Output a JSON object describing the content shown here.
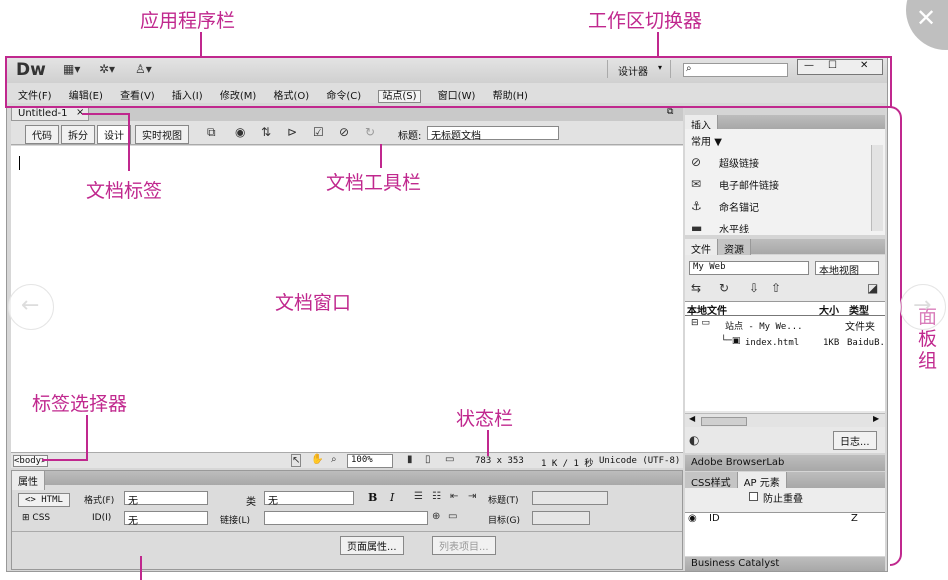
{
  "annotations": {
    "app_bar": "应用程序栏",
    "workspace_switcher": "工作区切换器",
    "doc_tab": "文档标签",
    "doc_toolbar": "文档工具栏",
    "doc_window": "文档窗口",
    "tag_selector": "标签选择器",
    "status_bar": "状态栏",
    "panel_group": "面板组"
  },
  "app": {
    "logo": "Dw",
    "workspace_label": "设计器",
    "window_min": "—",
    "window_max": "☐",
    "window_close": "✕"
  },
  "menu": [
    "文件(F)",
    "编辑(E)",
    "查看(V)",
    "插入(I)",
    "修改(M)",
    "格式(O)",
    "命令(C)",
    "站点(S)",
    "窗口(W)",
    "帮助(H)"
  ],
  "document": {
    "tab_name": "Untitled-1",
    "tab_close": "×",
    "view_buttons": [
      "代码",
      "拆分",
      "设计",
      "实时视图"
    ],
    "title_label": "标题:",
    "title_value": "无标题文档"
  },
  "statusbar": {
    "tag": "<body>",
    "zoom": "100%",
    "size": "783 x 353",
    "download": "1 K / 1 秒",
    "encoding": "Unicode (UTF-8)"
  },
  "properties": {
    "header": "属性",
    "html_btn": "HTML",
    "css_btn": "CSS",
    "format_label": "格式(F)",
    "format_value": "无",
    "class_label": "类",
    "class_value": "无",
    "id_label": "ID(I)",
    "id_value": "无",
    "link_label": "链接(L)",
    "link_value": "",
    "title_label": "标题(T)",
    "target_label": "目标(G)",
    "bold": "B",
    "italic": "I",
    "page_props_btn": "页面属性...",
    "list_item_btn": "列表项目..."
  },
  "panels": {
    "insert_tab": "插入",
    "insert_category": "常用",
    "insert_items": [
      "超级链接",
      "电子邮件链接",
      "命名锚记",
      "水平线"
    ],
    "files_tabs": [
      "文件",
      "资源"
    ],
    "site_value": "My Web",
    "view_value": "本地视图",
    "files_cols": [
      "本地文件",
      "大小",
      "类型"
    ],
    "files_rows": [
      {
        "name": "站点 - My We...",
        "size": "",
        "type": "文件夹"
      },
      {
        "name": "index.html",
        "size": "1KB",
        "type": "BaiduB."
      }
    ],
    "log_btn": "日志...",
    "browserlab": "Adobe BrowserLab",
    "css_tabs": [
      "CSS样式",
      "AP 元素"
    ],
    "prevent_overlap": "防止重叠",
    "ap_cols": [
      "ID",
      "Z"
    ],
    "business": "Business Catalyst"
  }
}
